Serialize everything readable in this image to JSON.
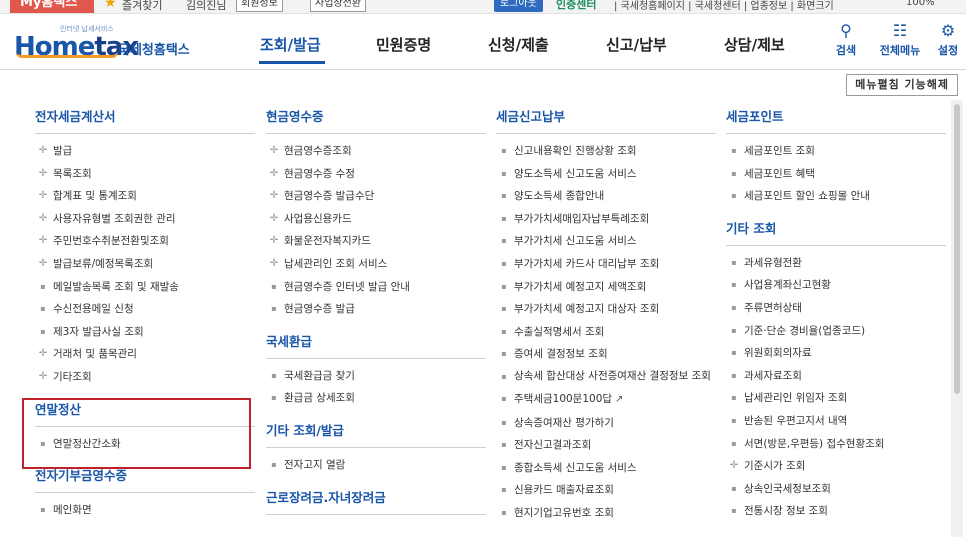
{
  "topbar": {
    "my_badge": "My홈택스",
    "favorites": "즐겨찾기",
    "user_name": "김의진님",
    "info_btn": "회원정보",
    "biz_btn": "사업장전환",
    "logout": "로그아웃",
    "center": "인증센터",
    "links": "| 국세청홈페이지 | 국세청센터 | 업종정보 | 화면크기",
    "zoom": "100%"
  },
  "header": {
    "logo_main": "Home",
    "logo_tax": "tax",
    "logo_sub": "인터넷 납세서비스",
    "logo_kor": "국세청홈택스",
    "nav": [
      "조회/발급",
      "민원증명",
      "신청/제출",
      "신고/납부",
      "상담/제보"
    ],
    "util": [
      {
        "icon": "search-icon",
        "glyph": "⌕",
        "label": "검색"
      },
      {
        "icon": "grid-icon",
        "glyph": "☷",
        "label": "전체메뉴"
      },
      {
        "icon": "gear-icon",
        "glyph": "⚙",
        "label": "설정"
      }
    ],
    "menu_close": "메뉴펼침 기능해제"
  },
  "columns": [
    {
      "sections": [
        {
          "title": "전자세금계산서",
          "items": [
            {
              "mk": "plus",
              "label": "발급"
            },
            {
              "mk": "plus",
              "label": "목록조회"
            },
            {
              "mk": "plus",
              "label": "합계표 및 통계조회"
            },
            {
              "mk": "plus",
              "label": "사용자유형별 조회권한 관리"
            },
            {
              "mk": "plus",
              "label": "주민번호수취분전환및조회"
            },
            {
              "mk": "plus",
              "label": "발급보류/예정목록조회"
            },
            {
              "mk": "dot",
              "label": "메일발송목록 조회 및 재발송"
            },
            {
              "mk": "dot",
              "label": "수신전용메일 신청"
            },
            {
              "mk": "dot",
              "label": "제3자 발급사실 조회"
            },
            {
              "mk": "plus",
              "label": "거래처 및 품목관리"
            },
            {
              "mk": "plus",
              "label": "기타조회"
            }
          ]
        },
        {
          "title": "연말정산",
          "items": [
            {
              "mk": "dot",
              "label": "연말정산간소화"
            }
          ]
        },
        {
          "title": "전자기부금영수증",
          "items": [
            {
              "mk": "dot",
              "label": "메인화면"
            }
          ]
        }
      ]
    },
    {
      "sections": [
        {
          "title": "현금영수증",
          "items": [
            {
              "mk": "plus",
              "label": "현금영수증조회"
            },
            {
              "mk": "plus",
              "label": "현금영수증 수정"
            },
            {
              "mk": "plus",
              "label": "현금영수증 발급수단"
            },
            {
              "mk": "plus",
              "label": "사업용신용카드"
            },
            {
              "mk": "plus",
              "label": "화물운전자복지카드"
            },
            {
              "mk": "plus",
              "label": "납세관리인 조회 서비스"
            },
            {
              "mk": "dot",
              "label": "현금영수증 인터넷 발급 안내"
            },
            {
              "mk": "dot",
              "label": "현금영수증 발급"
            }
          ]
        },
        {
          "title": "국세환급",
          "items": [
            {
              "mk": "dot",
              "label": "국세환급금 찾기"
            },
            {
              "mk": "dot",
              "label": "환급금 상세조회"
            }
          ]
        },
        {
          "title": "기타 조회/발급",
          "items": [
            {
              "mk": "dot",
              "label": "전자고지 열람"
            }
          ]
        },
        {
          "title": "근로장려금.자녀장려금",
          "items": []
        }
      ]
    },
    {
      "sections": [
        {
          "title": "세금신고납부",
          "items": [
            {
              "mk": "dot",
              "label": "신고내용확인 진행상황 조회"
            },
            {
              "mk": "dot",
              "label": "양도소득세 신고도움 서비스"
            },
            {
              "mk": "dot",
              "label": "양도소득세 종합안내"
            },
            {
              "mk": "dot",
              "label": "부가가치세매입자납부특례조회"
            },
            {
              "mk": "dot",
              "label": "부가가치세 신고도움 서비스"
            },
            {
              "mk": "dot",
              "label": "부가가치세 카드사 대리납부 조회"
            },
            {
              "mk": "dot",
              "label": "부가가치세 예정고지 세액조회"
            },
            {
              "mk": "dot",
              "label": "부가가치세 예정고지 대상자 조회"
            },
            {
              "mk": "dot",
              "label": "수출실적명세서 조회"
            },
            {
              "mk": "dot",
              "label": "증여세 결정정보 조회"
            },
            {
              "mk": "dot",
              "label": "상속세 합산대상 사전증여재산 결정정보 조회",
              "multi": true
            },
            {
              "mk": "dot",
              "label": "주택세금100문100답",
              "ext": "↗"
            },
            {
              "mk": "dot",
              "label": "상속증여재산 평가하기"
            },
            {
              "mk": "dot",
              "label": "전자신고결과조회"
            },
            {
              "mk": "dot",
              "label": "종합소득세 신고도움 서비스"
            },
            {
              "mk": "dot",
              "label": "신용카드 매출자료조회"
            },
            {
              "mk": "dot",
              "label": "현지기업고유번호 조회"
            }
          ]
        }
      ]
    },
    {
      "sections": [
        {
          "title": "세금포인트",
          "items": [
            {
              "mk": "dot",
              "label": "세금포인트 조회"
            },
            {
              "mk": "dot",
              "label": "세금포인트 혜택"
            },
            {
              "mk": "dot",
              "label": "세금포인트 할인 쇼핑몰 안내"
            }
          ]
        },
        {
          "title": "기타 조회",
          "items": [
            {
              "mk": "dot",
              "label": "과세유형전환"
            },
            {
              "mk": "dot",
              "label": "사업용계좌신고현황"
            },
            {
              "mk": "dot",
              "label": "주류면허상태"
            },
            {
              "mk": "dot",
              "label": "기준·단순 경비율(업종코드)"
            },
            {
              "mk": "dot",
              "label": "위원회회의자료"
            },
            {
              "mk": "dot",
              "label": "과세자료조회"
            },
            {
              "mk": "dot",
              "label": "납세관리인 위임자 조회"
            },
            {
              "mk": "dot",
              "label": "반송된 우편고지서 내역"
            },
            {
              "mk": "dot",
              "label": "서면(방문,우편등) 접수현황조회"
            },
            {
              "mk": "plus",
              "label": "기준시가 조회"
            },
            {
              "mk": "dot",
              "label": "상속인국세정보조회"
            },
            {
              "mk": "dot",
              "label": "전통시장 정보 조회"
            }
          ]
        }
      ]
    }
  ]
}
